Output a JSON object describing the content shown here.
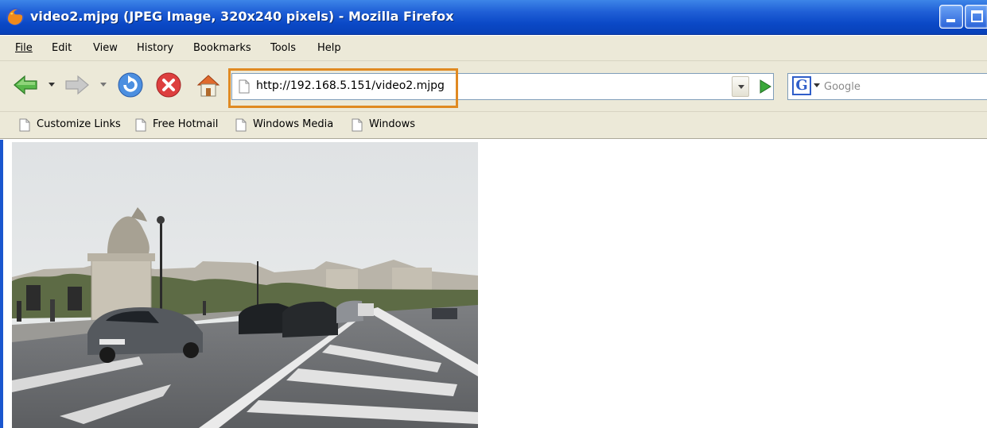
{
  "window": {
    "title": "video2.mjpg (JPEG Image, 320x240 pixels) - Mozilla Firefox",
    "app_icon": "firefox-icon"
  },
  "menu": {
    "items": [
      {
        "label": "File"
      },
      {
        "label": "Edit"
      },
      {
        "label": "View"
      },
      {
        "label": "History"
      },
      {
        "label": "Bookmarks"
      },
      {
        "label": "Tools"
      },
      {
        "label": "Help"
      }
    ]
  },
  "nav": {
    "url": "http://192.168.5.151/video2.mjpg",
    "search_placeholder": "Google",
    "search_engine_icon": "google-icon"
  },
  "bookmarks": {
    "items": [
      {
        "label": "Customize Links"
      },
      {
        "label": "Free Hotmail"
      },
      {
        "label": "Windows Media"
      },
      {
        "label": "Windows"
      }
    ]
  },
  "content": {
    "image_description_icon": "street-photo",
    "image_alt": "video2.mjpg"
  },
  "colors": {
    "titlebar": "#0a48c6",
    "chrome": "#ece9d8",
    "url_highlight": "#e08a22"
  }
}
